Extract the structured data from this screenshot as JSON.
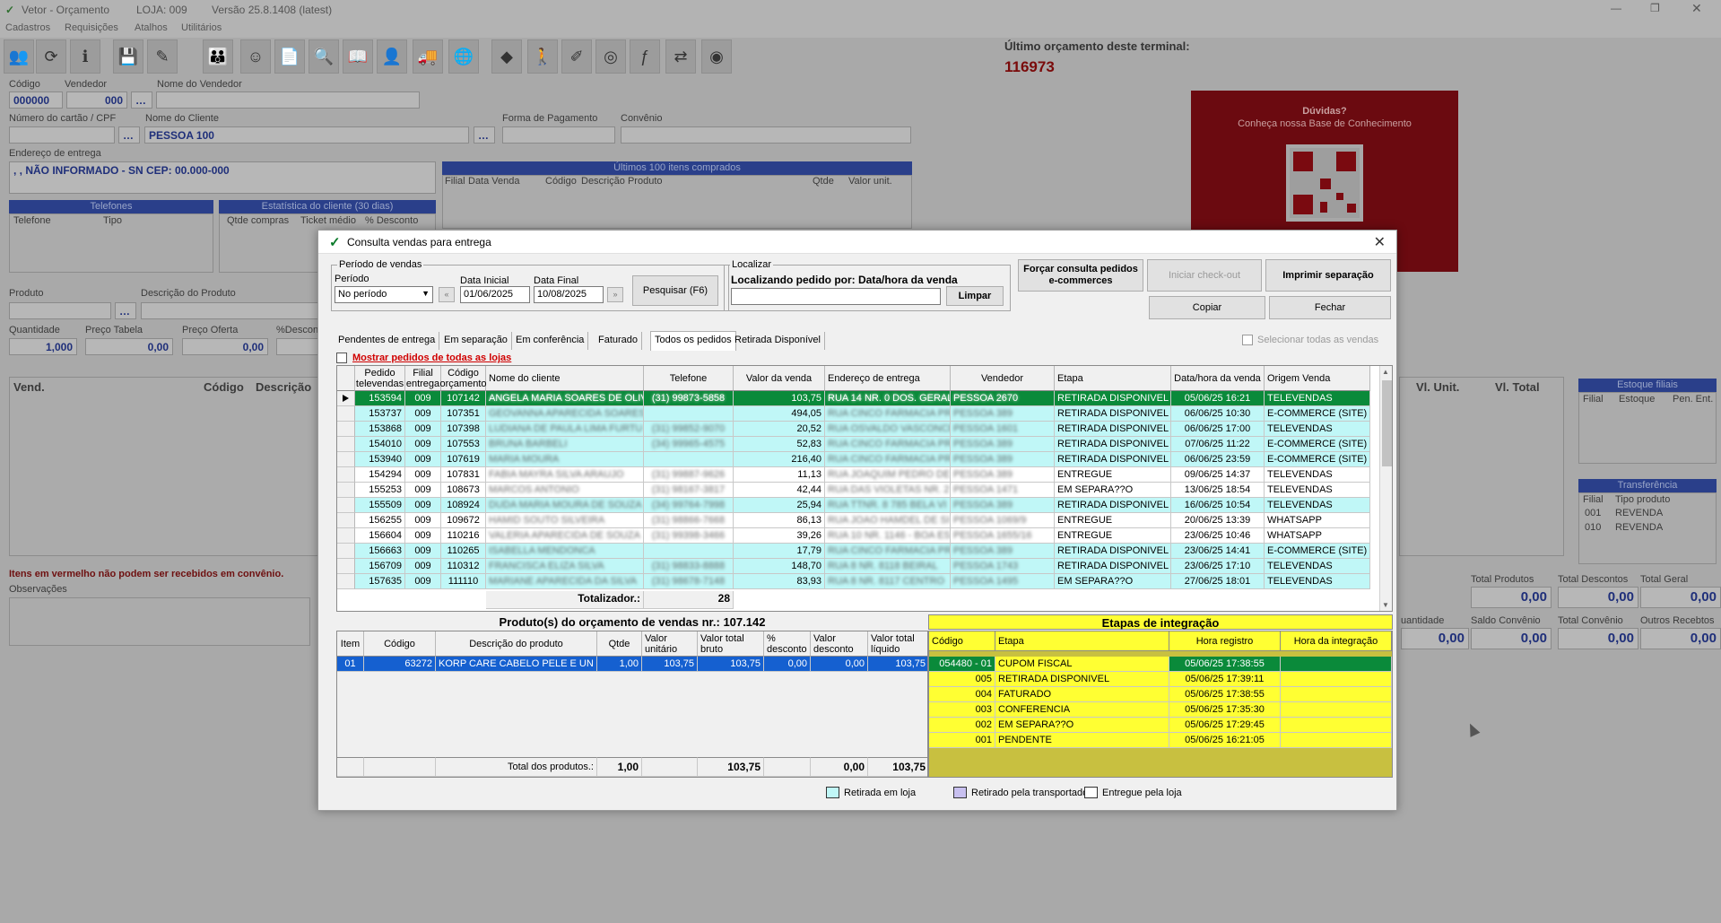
{
  "app": {
    "title": "Vetor - Orçamento",
    "loja": "LOJA: 009",
    "versao": "Versão 25.8.1408 (latest)",
    "menu": [
      "Cadastros",
      "Requisições",
      "Atalhos",
      "Utilitários"
    ],
    "last_order_label": "Último orçamento deste terminal:",
    "last_order_number": "116973",
    "help_title": "Dúvidas?",
    "help_subtitle": "Conheça nossa Base de Conhecimento",
    "form": {
      "codigo_label": "Código",
      "codigo_value": "000000",
      "vendedor_label": "Vendedor",
      "vendedor_value": "000",
      "nome_vendedor_label": "Nome do Vendedor",
      "cartao_label": "Número do cartão / CPF",
      "nome_cliente_label": "Nome do Cliente",
      "nome_cliente_value": "PESSOA 100",
      "forma_pagamento_label": "Forma de Pagamento",
      "convenio_label": "Convênio",
      "endereco_label": "Endereço de entrega",
      "endereco_value": ", , NÃO INFORMADO - SN CEP: 00.000-000",
      "ultimos_itens": "Últimos 100 itens comprados",
      "ultimos_cols": [
        "Filial",
        "Data Venda",
        "Código",
        "Descrição Produto",
        "Qtde",
        "Valor unit."
      ],
      "telefones": "Telefones",
      "tel_cols": [
        "Telefone",
        "Tipo"
      ],
      "estatistica": "Estatística do cliente (30 dias)",
      "est_cols": [
        "Qtde compras",
        "Ticket médio",
        "% Desconto"
      ],
      "produto_label": "Produto",
      "descricao_label": "Descrição do Produto",
      "quantidade_label": "Quantidade",
      "quantidade_value": "1,000",
      "preco_tabela_label": "Preço Tabela",
      "preco_tabela_value": "0,00",
      "preco_oferta_label": "Preço Oferta",
      "preco_oferta_value": "0,00",
      "desconto_label": "%Desconto",
      "grid_cols": [
        "Vend.",
        "Código",
        "Descrição"
      ],
      "right_cols": [
        "Vl. Unit.",
        "Vl. Total"
      ],
      "estoque_filiais": "Estoque filiais",
      "estoque_cols": [
        "Filial",
        "Estoque",
        "Pen. Ent."
      ],
      "transferencia": "Transferência",
      "transf_cols": [
        "Filial",
        "Tipo produto"
      ],
      "transf_rows": [
        [
          "001",
          "REVENDA"
        ],
        [
          "010",
          "REVENDA"
        ]
      ],
      "warning": "Itens em vermelho não podem ser recebidos em convênio.",
      "observacoes_label": "Observações",
      "totais": [
        {
          "label": "Total Produtos",
          "value": "0,00"
        },
        {
          "label": "Total Descontos",
          "value": "0,00"
        },
        {
          "label": "Total Geral",
          "value": "0,00"
        },
        {
          "label": "uantidade",
          "value": "0,00"
        },
        {
          "label": "Saldo Convênio",
          "value": "0,00"
        },
        {
          "label": "Total Convênio",
          "value": "0,00"
        },
        {
          "label": "Outros Recebtos",
          "value": "0,00"
        }
      ]
    }
  },
  "dialog": {
    "title": "Consulta vendas para entrega",
    "periodo_group": "Período de vendas",
    "periodo_label": "Período",
    "periodo_value": "No período",
    "data_inicial_label": "Data Inicial",
    "data_inicial": "01/06/2025",
    "data_final_label": "Data Final",
    "data_final": "10/08/2025",
    "pesquisar": "Pesquisar (F6)",
    "localizar_group": "Localizar",
    "localizar_text": "Localizando pedido por: Data/hora da venda",
    "limpar": "Limpar",
    "forcar": "Forçar consulta pedidos e-commerces",
    "iniciar_checkout": "Iniciar check-out",
    "imprimir": "Imprimir separação",
    "copiar": "Copiar",
    "fechar": "Fechar",
    "tabs": [
      "Pendentes de entrega",
      "Em separação",
      "Em conferência",
      "Faturado",
      "Todos os pedidos",
      "Retirada Disponível"
    ],
    "active_tab": 4,
    "selecionar_todas": "Selecionar todas as vendas",
    "mostrar_todas": "Mostrar pedidos de todas as lojas",
    "columns": [
      "Pedido televendas",
      "Filial entrega",
      "Código orçamento",
      "Nome do cliente",
      "Telefone",
      "Valor da venda",
      "Endereço de entrega",
      "Vendedor",
      "Etapa",
      "Data/hora da venda",
      "Origem Venda"
    ],
    "rows": [
      {
        "pedido": "153594",
        "filial": "009",
        "codigo": "107142",
        "cliente": "ANGELA MARIA SOARES DE OLIV",
        "telefone": "(31) 99873-5858",
        "valor": "103,75",
        "endereco": "RUA 14 NR. 0 DOS. GERAL",
        "vendedor": "PESSOA 2670",
        "etapa": "RETIRADA DISPONIVEL",
        "data": "05/06/25 16:21",
        "origem": "TELEVENDAS",
        "style": "sel"
      },
      {
        "pedido": "153737",
        "filial": "009",
        "codigo": "107351",
        "cliente": "GEOVANNA APARECIDA SOARES",
        "telefone": "",
        "valor": "494,05",
        "endereco": "RUA CINCO FARMACIA PRI",
        "vendedor": "PESSOA 389",
        "etapa": "RETIRADA DISPONIVEL",
        "data": "06/06/25 10:30",
        "origem": "E-COMMERCE (SITE)",
        "style": "cyan"
      },
      {
        "pedido": "153868",
        "filial": "009",
        "codigo": "107398",
        "cliente": "LUDIANA DE PAULA LIMA FURTU",
        "telefone": "(31) 99852-9070",
        "valor": "20,52",
        "endereco": "RUA OSVALDO VASCONCE",
        "vendedor": "PESSOA 1601",
        "etapa": "RETIRADA DISPONIVEL",
        "data": "06/06/25 17:00",
        "origem": "TELEVENDAS",
        "style": "cyan"
      },
      {
        "pedido": "154010",
        "filial": "009",
        "codigo": "107553",
        "cliente": "BRUNA BARBELI",
        "telefone": "(34) 99965-4575",
        "valor": "52,83",
        "endereco": "RUA CINCO FARMACIA PRI",
        "vendedor": "PESSOA 389",
        "etapa": "RETIRADA DISPONIVEL",
        "data": "07/06/25 11:22",
        "origem": "E-COMMERCE (SITE)",
        "style": "cyan"
      },
      {
        "pedido": "153940",
        "filial": "009",
        "codigo": "107619",
        "cliente": "MARIA MOURA",
        "telefone": "",
        "valor": "216,40",
        "endereco": "RUA CINCO FARMACIA PRI",
        "vendedor": "PESSOA 389",
        "etapa": "RETIRADA DISPONIVEL",
        "data": "06/06/25 23:59",
        "origem": "E-COMMERCE (SITE)",
        "style": "cyan"
      },
      {
        "pedido": "154294",
        "filial": "009",
        "codigo": "107831",
        "cliente": "FABIA MAYRA SILVA ARAUJO",
        "telefone": "(31) 99887-9626",
        "valor": "11,13",
        "endereco": "RUA JOAQUIM PEDRO DE",
        "vendedor": "PESSOA 389",
        "etapa": "ENTREGUE",
        "data": "09/06/25 14:37",
        "origem": "TELEVENDAS",
        "style": "white"
      },
      {
        "pedido": "155253",
        "filial": "009",
        "codigo": "108673",
        "cliente": "MARCOS ANTONIO",
        "telefone": "(31) 98167-3817",
        "valor": "42,44",
        "endereco": "RUA DAS VIOLETAS NR. 2",
        "vendedor": "PESSOA 1471",
        "etapa": "EM SEPARA??O",
        "data": "13/06/25 18:54",
        "origem": "TELEVENDAS",
        "style": "white"
      },
      {
        "pedido": "155509",
        "filial": "009",
        "codigo": "108924",
        "cliente": "DUDA MARIA MOURA DE SOUZA",
        "telefone": "(34) 99764-7998",
        "valor": "25,94",
        "endereco": "RUA TTNR. 8 785 BELA VI",
        "vendedor": "PESSOA 389",
        "etapa": "RETIRADA DISPONIVEL",
        "data": "16/06/25 10:54",
        "origem": "TELEVENDAS",
        "style": "cyan"
      },
      {
        "pedido": "156255",
        "filial": "009",
        "codigo": "109672",
        "cliente": "HAMID SOUTO SILVEIRA",
        "telefone": "(31) 98866-7668",
        "valor": "86,13",
        "endereco": "RUA JOAO HAMDEL DE SI",
        "vendedor": "PESSOA 1069/9",
        "etapa": "ENTREGUE",
        "data": "20/06/25 13:39",
        "origem": "WHATSAPP",
        "style": "white"
      },
      {
        "pedido": "156604",
        "filial": "009",
        "codigo": "110216",
        "cliente": "VALERIA APARECIDA DE SOUZA",
        "telefone": "(31) 99398-3466",
        "valor": "39,26",
        "endereco": "RUA 10 NR. 1146 - BOA ES",
        "vendedor": "PESSOA 1655/16",
        "etapa": "ENTREGUE",
        "data": "23/06/25 10:46",
        "origem": "WHATSAPP",
        "style": "white"
      },
      {
        "pedido": "156663",
        "filial": "009",
        "codigo": "110265",
        "cliente": "ISABELLA MENDONCA",
        "telefone": "",
        "valor": "17,79",
        "endereco": "RUA CINCO FARMACIA PRI",
        "vendedor": "PESSOA 389",
        "etapa": "RETIRADA DISPONIVEL",
        "data": "23/06/25 14:41",
        "origem": "E-COMMERCE (SITE)",
        "style": "cyan"
      },
      {
        "pedido": "156709",
        "filial": "009",
        "codigo": "110312",
        "cliente": "FRANCISCA ELIZA SILVA",
        "telefone": "(31) 98833-8888",
        "valor": "148,70",
        "endereco": "RUA 8 NR. 8118 BEIRAL",
        "vendedor": "PESSOA 1743",
        "etapa": "RETIRADA DISPONIVEL",
        "data": "23/06/25 17:10",
        "origem": "TELEVENDAS",
        "style": "cyan"
      },
      {
        "pedido": "157635",
        "filial": "009",
        "codigo": "111110",
        "cliente": "MARIANE APARECIDA DA SILVA",
        "telefone": "(31) 98678-7148",
        "valor": "83,93",
        "endereco": "RUA 8 NR. 8117 CENTRO",
        "vendedor": "PESSOA 1495",
        "etapa": "EM SEPARA??O",
        "data": "27/06/25 18:01",
        "origem": "TELEVENDAS",
        "style": "cyan"
      }
    ],
    "totalizador_label": "Totalizador.:",
    "totalizador_value": "28",
    "produtos_title": "Produto(s) do orçamento de vendas nr.: 107.142",
    "prod_columns": [
      "Item",
      "Código",
      "Descrição do produto",
      "Qtde",
      "Valor unitário",
      "Valor total bruto",
      "% desconto",
      "Valor desconto",
      "Valor total líquido"
    ],
    "prod_rows": [
      {
        "item": "01",
        "codigo": "63272",
        "descricao": "KORP CARE CABELO PELE E UN",
        "qtde": "1,00",
        "unit": "103,75",
        "bruto": "103,75",
        "pct": "0,00",
        "desc": "0,00",
        "liquido": "103,75"
      }
    ],
    "prod_total_label": "Total dos produtos.:",
    "prod_total_qtde": "1,00",
    "prod_total_bruto": "103,75",
    "prod_total_desc": "0,00",
    "prod_total_liquido": "103,75",
    "etapas_title": "Etapas de integração",
    "etapas_columns": [
      "Código",
      "Etapa",
      "Hora registro",
      "Hora da integração"
    ],
    "etapas_rows": [
      {
        "codigo": "054480 - 01",
        "etapa": "CUPOM FISCAL",
        "registro": "05/06/25 17:38:55",
        "integracao": "",
        "sel": true
      },
      {
        "codigo": "005",
        "etapa": "RETIRADA DISPONIVEL",
        "registro": "05/06/25 17:39:11",
        "integracao": "",
        "sel": false
      },
      {
        "codigo": "004",
        "etapa": "FATURADO",
        "registro": "05/06/25 17:38:55",
        "integracao": "",
        "sel": false
      },
      {
        "codigo": "003",
        "etapa": "CONFERENCIA",
        "registro": "05/06/25 17:35:30",
        "integracao": "",
        "sel": false
      },
      {
        "codigo": "002",
        "etapa": "EM SEPARA??O",
        "registro": "05/06/25 17:29:45",
        "integracao": "",
        "sel": false
      },
      {
        "codigo": "001",
        "etapa": "PENDENTE",
        "registro": "05/06/25 16:21:05",
        "integracao": "",
        "sel": false
      }
    ],
    "legend": [
      {
        "label": "Retirada em loja",
        "color": "#c0f7f7"
      },
      {
        "label": "Retirado pela transportadora",
        "color": "#c8c0f0"
      },
      {
        "label": "Entregue pela loja",
        "color": "#ffffff"
      }
    ]
  }
}
